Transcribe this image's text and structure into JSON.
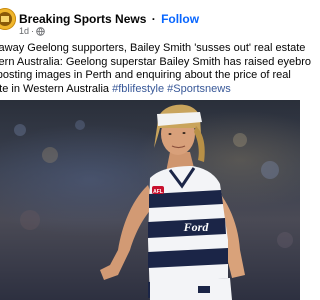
{
  "post": {
    "page_name": "Breaking Sports News",
    "separator": "·",
    "follow_label": "Follow",
    "time": "1d",
    "privacy_separator": "·",
    "caption_lines": [
      "k away Geelong supporters, Bailey Smith 'susses out' real estate",
      "stern Australia: Geelong superstar Bailey Smith has raised eyebro",
      "r posting images in Perth and enquiring about the price of real",
      "tate in Western Australia "
    ],
    "hashtags": [
      "#fblifestyle",
      "#Sportsnews"
    ]
  },
  "photo": {
    "jersey_text": "Ford",
    "logo_text": "AFL"
  },
  "colors": {
    "follow": "#0866ff",
    "hashtag": "#385898",
    "meta": "#65676b",
    "jersey_navy": "#1b2547",
    "headband": "#f2f2f2"
  },
  "icons": {
    "avatar": "breaking-sports-news-logo",
    "privacy": "globe-icon"
  }
}
